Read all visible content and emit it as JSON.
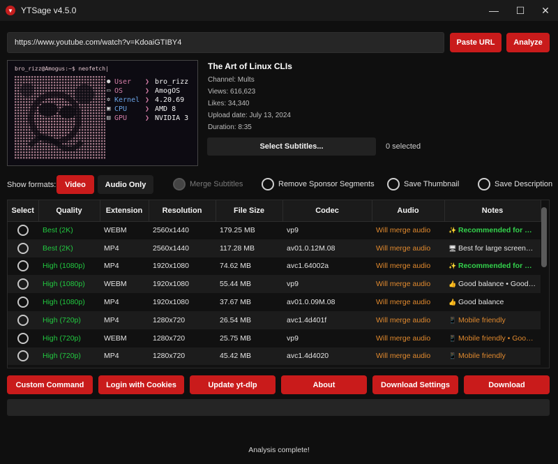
{
  "window": {
    "title": "YTSage  v4.5.0",
    "icon": "app-logo-icon",
    "controls": {
      "minimize": "—",
      "maximize": "☐",
      "close": "✕"
    }
  },
  "url_bar": {
    "value": "https://www.youtube.com/watch?v=KdoaiGTIBY4",
    "paste_label": "Paste URL",
    "analyze_label": "Analyze"
  },
  "thumbnail": {
    "prompt": "bro_rizz@Amogus:~$ neofetch|",
    "rows": [
      {
        "icon": "user-icon",
        "key": "User",
        "value": "bro_rizz"
      },
      {
        "icon": "monitor-icon",
        "key": "OS",
        "value": "AmogOS"
      },
      {
        "icon": "gear-icon",
        "key": "Kernel",
        "value": "4.20.69"
      },
      {
        "icon": "chip-icon",
        "key": "CPU",
        "value": "AMD 8"
      },
      {
        "icon": "gpu-icon",
        "key": "GPU",
        "value": "NVIDIA 3"
      }
    ],
    "arrow": "❯"
  },
  "video": {
    "title": "The Art of Linux CLIs",
    "channel": "Channel: Mults",
    "views": "Views: 616,623",
    "likes": "Likes: 34,340",
    "upload_date": "Upload date: July 13, 2024",
    "duration": "Duration: 8:35"
  },
  "subtitles": {
    "button_label": "Select Subtitles...",
    "count": "0 selected"
  },
  "formats": {
    "label": "Show formats:",
    "video_label": "Video",
    "audio_label": "Audio Only",
    "options": {
      "merge": "Merge Subtitles",
      "sponsor": "Remove Sponsor Segments",
      "thumbnail": "Save Thumbnail",
      "description": "Save Description"
    }
  },
  "table": {
    "headers": {
      "select": "Select",
      "quality": "Quality",
      "extension": "Extension",
      "resolution": "Resolution",
      "size": "File Size",
      "codec": "Codec",
      "audio": "Audio",
      "notes": "Notes"
    },
    "rows": [
      {
        "quality": "Best (2K)",
        "ext": "WEBM",
        "res": "2560x1440",
        "size": "179.25 MB",
        "codec": "vp9",
        "audio": "Will merge audio",
        "note_icon": "✨",
        "note": "Recommended for high-c...",
        "note_style": "green"
      },
      {
        "quality": "Best (2K)",
        "ext": "MP4",
        "res": "2560x1440",
        "size": "117.28 MB",
        "codec": "av01.0.12M.08",
        "audio": "Will merge audio",
        "note_icon": "🖥",
        "note": "Best for large screens • Lar...",
        "note_style": "white"
      },
      {
        "quality": "High (1080p)",
        "ext": "MP4",
        "res": "1920x1080",
        "size": "74.62 MB",
        "codec": "avc1.64002a",
        "audio": "Will merge audio",
        "note_icon": "✨",
        "note": "Recommended for most ...",
        "note_style": "green"
      },
      {
        "quality": "High (1080p)",
        "ext": "WEBM",
        "res": "1920x1080",
        "size": "55.44 MB",
        "codec": "vp9",
        "audio": "Will merge audio",
        "note_icon": "👍",
        "note": "Good balance • Good for ...",
        "note_style": "white"
      },
      {
        "quality": "High (1080p)",
        "ext": "MP4",
        "res": "1920x1080",
        "size": "37.67 MB",
        "codec": "av01.0.09M.08",
        "audio": "Will merge audio",
        "note_icon": "👍",
        "note": "Good balance",
        "note_style": "white"
      },
      {
        "quality": "High (720p)",
        "ext": "MP4",
        "res": "1280x720",
        "size": "26.54 MB",
        "codec": "avc1.4d401f",
        "audio": "Will merge audio",
        "note_icon": "📱",
        "note": "Mobile friendly",
        "note_style": "orange"
      },
      {
        "quality": "High (720p)",
        "ext": "WEBM",
        "res": "1280x720",
        "size": "25.75 MB",
        "codec": "vp9",
        "audio": "Will merge audio",
        "note_icon": "📱",
        "note": "Mobile friendly • Good for ...",
        "note_style": "orange"
      },
      {
        "quality": "High (720p)",
        "ext": "MP4",
        "res": "1280x720",
        "size": "45.42 MB",
        "codec": "avc1.4d4020",
        "audio": "Will merge audio",
        "note_icon": "📱",
        "note": "Mobile friendly",
        "note_style": "orange"
      }
    ]
  },
  "actions": {
    "custom_command": "Custom Command",
    "login_cookies": "Login with Cookies",
    "update": "Update yt-dlp",
    "about": "About",
    "download_settings": "Download Settings",
    "download": "Download"
  },
  "progress": {
    "fraction": 0
  },
  "status": "Analysis complete!",
  "colors": {
    "accent": "#c91b1b",
    "quality_green": "#22c940",
    "audio_orange": "#e0892e",
    "background": "#0f0f0f"
  }
}
